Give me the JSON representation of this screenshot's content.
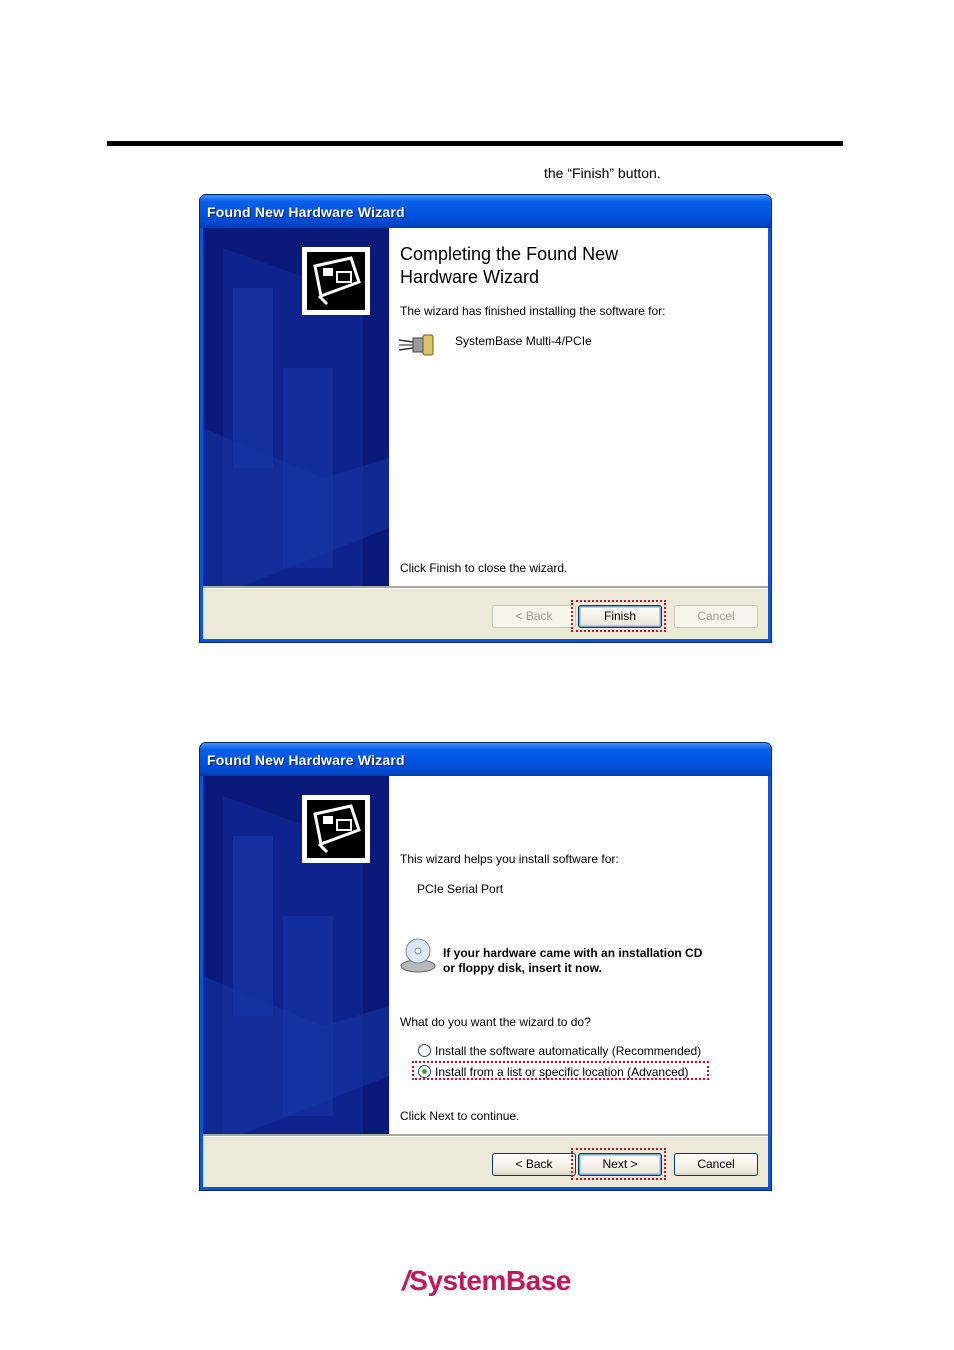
{
  "caption": "the “Finish” button.",
  "wizard1": {
    "title": "Found New Hardware Wizard",
    "heading_line1": "Completing the Found New",
    "heading_line2": "Hardware Wizard",
    "intro": "The wizard has finished installing the software for:",
    "device_name": "SystemBase Multi-4/PCIe",
    "device_icon": "serial-port-icon",
    "footer_text": "Click Finish to close the wizard.",
    "back_label": "< Back",
    "finish_label": "Finish",
    "cancel_label": "Cancel"
  },
  "wizard2": {
    "title": "Found New Hardware Wizard",
    "intro": "This wizard helps you install software for:",
    "device_name": "PCIe Serial Port",
    "cd_line1": "If your hardware came with an installation CD",
    "cd_line2": "or floppy disk, insert it now.",
    "cd_icon": "cd-drive-icon",
    "question": "What do you want the wizard to do?",
    "option_auto": "Install the software automatically (Recommended)",
    "option_list": "Install from a list or specific location (Advanced)",
    "selected_option": "option_list",
    "footer_text": "Click Next to continue.",
    "back_label": "< Back",
    "next_label": "Next >",
    "cancel_label": "Cancel"
  },
  "brand": {
    "logo_text": "SystemBase"
  },
  "colors": {
    "highlight": "#c8102e",
    "titlebar": "#0054e3",
    "brand": "#c2185b"
  }
}
